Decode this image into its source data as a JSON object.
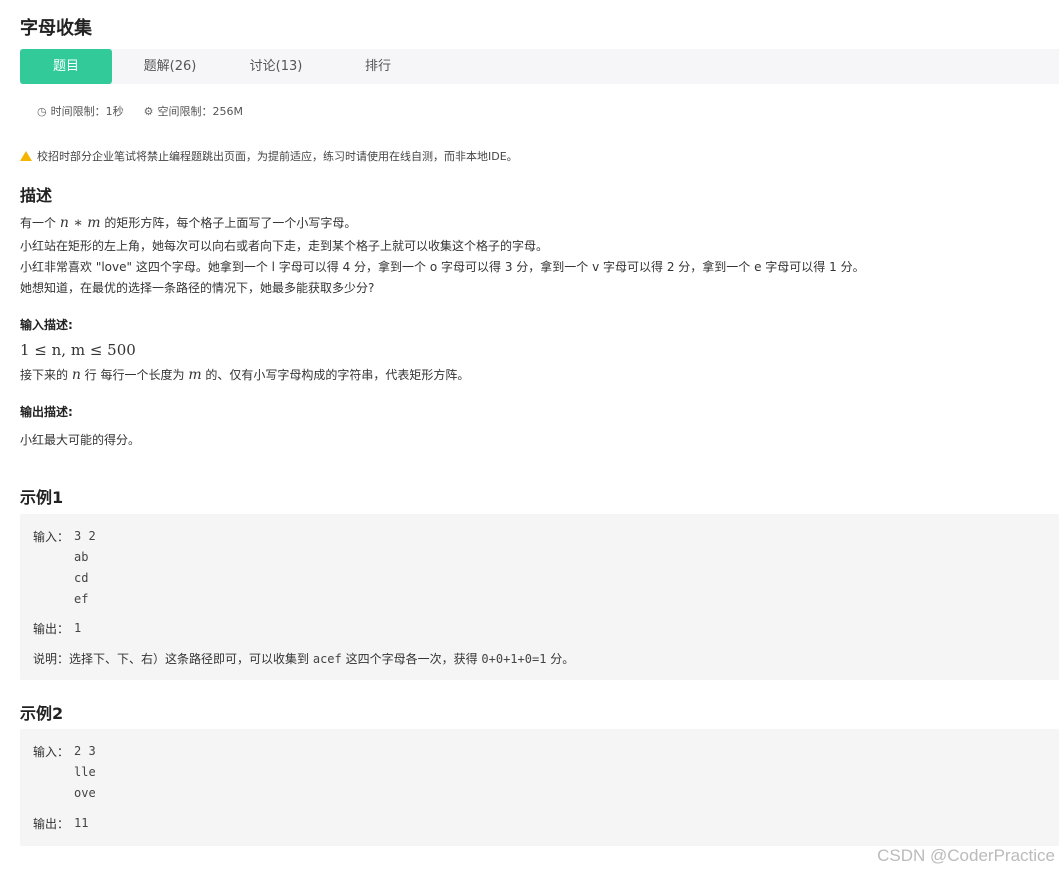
{
  "title": "字母收集",
  "tabs": [
    {
      "label": "题目"
    },
    {
      "label": "题解(26)"
    },
    {
      "label": "讨论(13)"
    },
    {
      "label": "排行"
    }
  ],
  "limits": {
    "time": "时间限制：1秒",
    "space": "空间限制：256M"
  },
  "notice": "校招时部分企业笔试将禁止编程题跳出页面，为提前适应，练习时请使用在线自测，而非本地IDE。",
  "description": {
    "heading": "描述",
    "line1_pre": "有一个 ",
    "line1_math": "n ∗ m",
    "line1_post": " 的矩形方阵，每个格子上面写了一个小写字母。",
    "line2": "小红站在矩形的左上角，她每次可以向右或者向下走，走到某个格子上就可以收集这个格子的字母。",
    "line3": "小红非常喜欢 \"love\" 这四个字母。她拿到一个 l 字母可以得 4 分，拿到一个 o 字母可以得 3 分，拿到一个 v 字母可以得 2 分，拿到一个 e 字母可以得 1 分。",
    "line4": "她想知道，在最优的选择一条路径的情况下，她最多能获取多少分?"
  },
  "input_desc": {
    "heading": "输入描述:",
    "constraint": "1 ≤ n, m ≤ 500",
    "line_pre": "接下来的 ",
    "line_math1": "n",
    "line_mid": " 行 每行一个长度为 ",
    "line_math2": "m",
    "line_post": " 的、仅有小写字母构成的字符串，代表矩形方阵。"
  },
  "output_desc": {
    "heading": "输出描述:",
    "text": "小红最大可能的得分。"
  },
  "example1": {
    "heading": "示例1",
    "input_label": "输入：",
    "input_lines": [
      "3 2",
      "ab",
      "cd",
      "ef"
    ],
    "output_label": "输出：",
    "output": "1",
    "explain_label": "说明：",
    "explain_pre": "选择下、下、右）这条路径即可，可以收集到 ",
    "explain_code1": "acef",
    "explain_mid": " 这四个字母各一次，获得 ",
    "explain_code2": "0+0+1+0=1",
    "explain_post": " 分。"
  },
  "example2": {
    "heading": "示例2",
    "input_label": "输入：",
    "input_lines": [
      "2 3",
      "lle",
      "ove"
    ],
    "output_label": "输出：",
    "output": "11"
  },
  "watermark": "CSDN @CoderPractice",
  "colors": {
    "accent": "#32ca99",
    "warning": "#f5b400"
  },
  "icons": {
    "time": "clock-icon",
    "space": "chip-icon",
    "notice": "warning-icon"
  }
}
